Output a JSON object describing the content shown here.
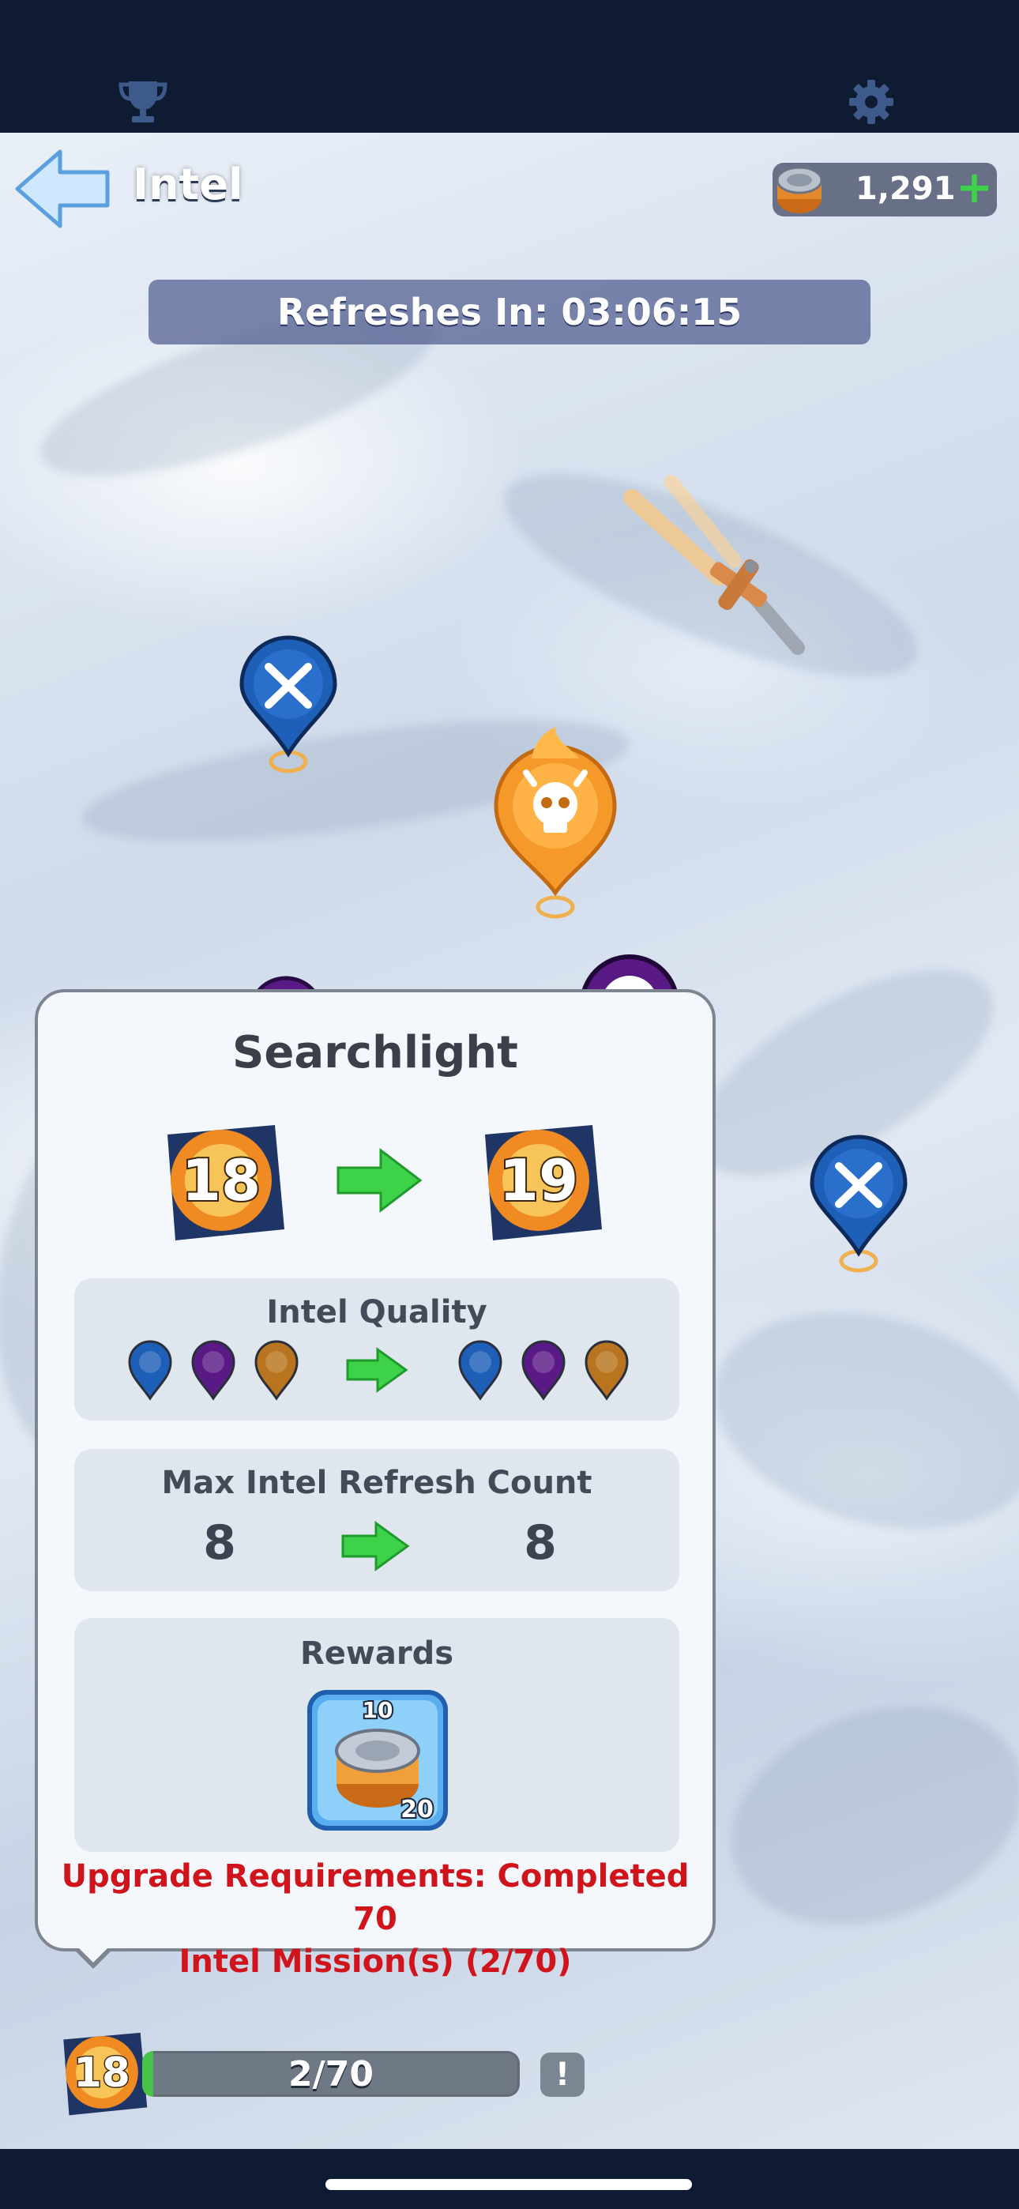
{
  "header": {
    "title": "Intel",
    "currency_value": "1,291",
    "refresh_text": "Refreshes In: 03:06:15"
  },
  "popup": {
    "title": "Searchlight",
    "level_from": "18",
    "level_to": "19",
    "intel_quality_label": "Intel Quality",
    "intel_quality_from": [
      "blue",
      "purple",
      "gold"
    ],
    "intel_quality_to": [
      "blue",
      "purple",
      "gold"
    ],
    "max_refresh_label": "Max Intel Refresh Count",
    "max_refresh_from": "8",
    "max_refresh_to": "8",
    "rewards_label": "Rewards",
    "reward_item": {
      "top_count": "10",
      "bottom_count": "20"
    },
    "requirement_line1": "Upgrade Requirements: Completed 70",
    "requirement_line2": "Intel Mission(s) (2/70)"
  },
  "bottom": {
    "level": "18",
    "progress_text": "2/70",
    "progress_fraction": 0.0286,
    "alert_label": "!"
  },
  "colors": {
    "topbar": "#0f1a33",
    "accent_green": "#3ed24a",
    "requirement_red": "#d0141c",
    "pin_blue": "#1e5fb8",
    "pin_purple": "#5a1a86",
    "pin_gold": "#b8741e"
  }
}
